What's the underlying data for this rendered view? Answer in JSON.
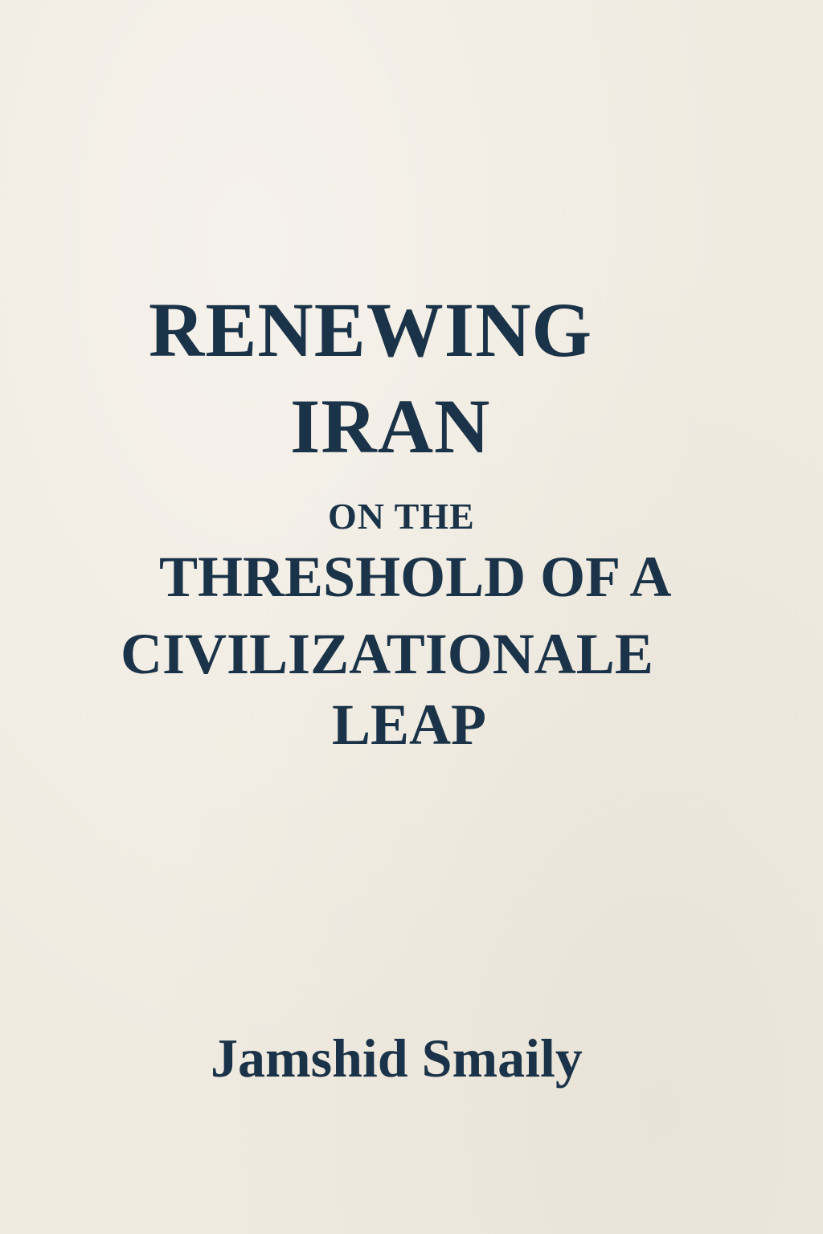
{
  "cover": {
    "title_line_1": "RENEWING",
    "title_line_2": "IRAN",
    "subtitle_line_1": "ON THE",
    "subtitle_line_2": "THRESHOLD OF A",
    "subtitle_line_3": "CIVILIZATIONALE",
    "subtitle_line_4": "LEAP",
    "author": "Jamshid Smaily",
    "text_color": "#1b3348",
    "background_color": "#f0ebe1"
  }
}
